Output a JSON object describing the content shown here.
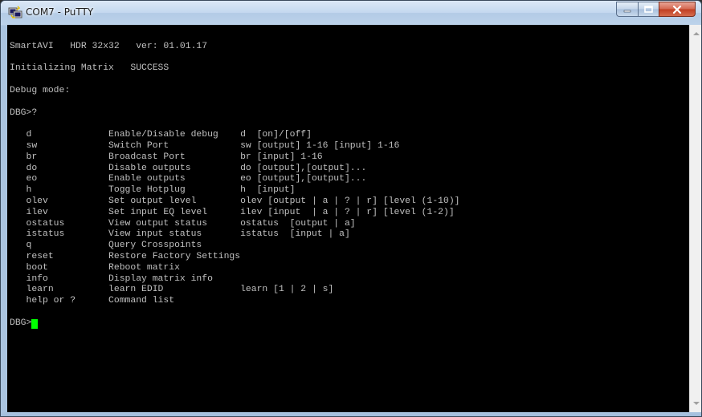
{
  "window": {
    "title": "COM7 - PuTTY",
    "app_icon": "putty-icon",
    "controls": [
      "minimize-icon",
      "maximize-icon",
      "close-icon"
    ]
  },
  "terminal": {
    "lines": [
      "",
      "SmartAVI   HDR 32x32   ver: 01.01.17",
      "",
      "Initializing Matrix   SUCCESS",
      "",
      "Debug mode:",
      "",
      "DBG>?",
      "",
      "   d              Enable/Disable debug    d  [on]/[off]",
      "   sw             Switch Port             sw [output] 1-16 [input] 1-16",
      "   br             Broadcast Port          br [input] 1-16",
      "   do             Disable outputs         do [output],[output]...",
      "   eo             Enable outputs          eo [output],[output]...",
      "   h              Toggle Hotplug          h  [input]",
      "   olev           Set output level        olev [output | a | ? | r] [level (1-10)]",
      "   ilev           Set input EQ level      ilev [input  | a | ? | r] [level (1-2)]",
      "   ostatus        View output status      ostatus  [output | a]",
      "   istatus        View input status       istatus  [input | a]",
      "   q              Query Crosspoints",
      "   reset          Restore Factory Settings",
      "   boot           Reboot matrix",
      "   info           Display matrix info",
      "   learn          learn EDID              learn [1 | 2 | s]",
      "   help or ?      Command list",
      ""
    ],
    "prompt": "DBG>",
    "cursor_color": "#00ff00",
    "text_color": "#c0c0c0",
    "background": "#000000"
  },
  "scrollbar": {
    "up_icon": "scroll-up-arrow-icon",
    "down_icon": "scroll-down-arrow-icon"
  }
}
